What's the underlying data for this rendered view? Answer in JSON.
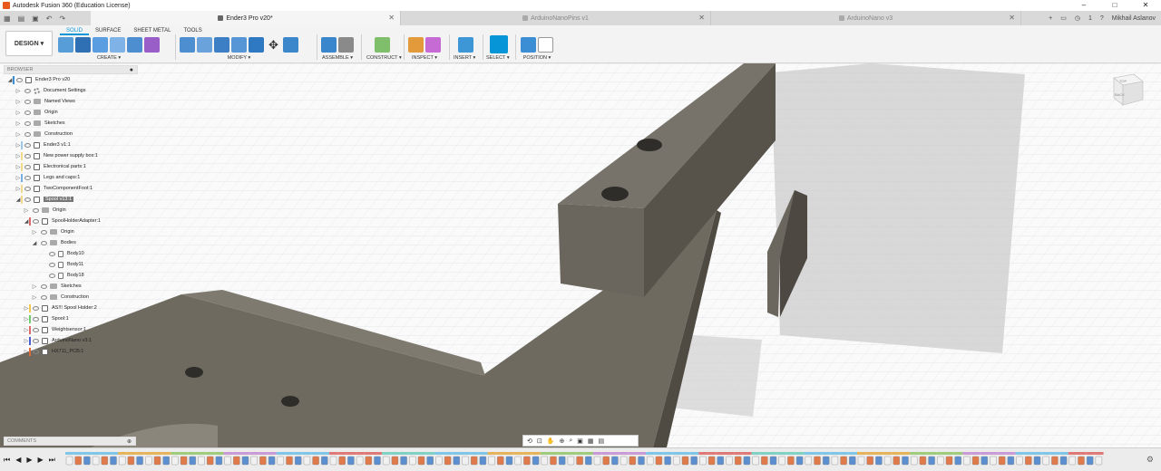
{
  "titlebar": {
    "title": "Autodesk Fusion 360 (Education License)",
    "buttons": [
      "–",
      "□",
      "✕"
    ]
  },
  "tabs": [
    {
      "label": "Ender3 Pro v20*",
      "active": true
    },
    {
      "label": "ArduinoNanoPins v1",
      "active": false
    },
    {
      "label": "ArduinoNano v3",
      "active": false
    }
  ],
  "topright": {
    "notifications": "1",
    "user": "Mikhail Aslanov"
  },
  "toolbar": {
    "design_label": "DESIGN ▾",
    "workspace_tabs": [
      "SOLID",
      "SURFACE",
      "SHEET METAL",
      "TOOLS"
    ],
    "groups": [
      {
        "label": "CREATE ▾"
      },
      {
        "label": "MODIFY ▾"
      },
      {
        "label": "ASSEMBLE ▾"
      },
      {
        "label": "CONSTRUCT ▾"
      },
      {
        "label": "INSPECT ▾"
      },
      {
        "label": "INSERT ▾"
      },
      {
        "label": "SELECT ▾"
      },
      {
        "label": "POSITION ▾"
      }
    ]
  },
  "browser": {
    "title": "BROWSER",
    "items": [
      {
        "label": "Ender3 Pro v20",
        "indent": 0,
        "icon": "doc",
        "expand": "◢",
        "bar": "#3d8fd6"
      },
      {
        "label": "Document Settings",
        "indent": 1,
        "icon": "gear",
        "expand": "▷",
        "bar": ""
      },
      {
        "label": "Named Views",
        "indent": 1,
        "icon": "folder",
        "expand": "▷",
        "bar": ""
      },
      {
        "label": "Origin",
        "indent": 1,
        "icon": "folder",
        "expand": "▷",
        "bar": ""
      },
      {
        "label": "Sketches",
        "indent": 1,
        "icon": "folder",
        "expand": "▷",
        "bar": ""
      },
      {
        "label": "Construction",
        "indent": 1,
        "icon": "folder",
        "expand": "▷",
        "bar": ""
      },
      {
        "label": "Ender3 v1:1",
        "indent": 1,
        "icon": "comp",
        "expand": "▷",
        "bar": "#9fc9ea"
      },
      {
        "label": "New power supply box:1",
        "indent": 1,
        "icon": "comp",
        "expand": "▷",
        "bar": "#f2d98b"
      },
      {
        "label": "Electronical parts:1",
        "indent": 1,
        "icon": "comp",
        "expand": "▷",
        "bar": "#f2d98b"
      },
      {
        "label": "Legs and caps:1",
        "indent": 1,
        "icon": "comp",
        "expand": "▷",
        "bar": "#7ab0e0"
      },
      {
        "label": "TwoComponentFoot:1",
        "indent": 1,
        "icon": "comp",
        "expand": "▷",
        "bar": "#f2d98b"
      },
      {
        "label": "Spool v13:1",
        "indent": 1,
        "icon": "comp",
        "expand": "◢",
        "bar": "#f2d98b",
        "highlight": true
      },
      {
        "label": "Origin",
        "indent": 2,
        "icon": "folder",
        "expand": "▷",
        "bar": ""
      },
      {
        "label": "SpoolHolderAdapter:1",
        "indent": 2,
        "icon": "comp",
        "expand": "◢",
        "bar": "#e06b6b"
      },
      {
        "label": "Origin",
        "indent": 3,
        "icon": "folder",
        "expand": "▷",
        "bar": ""
      },
      {
        "label": "Bodies",
        "indent": 3,
        "icon": "folder",
        "expand": "◢",
        "bar": ""
      },
      {
        "label": "Body10",
        "indent": 4,
        "icon": "body",
        "expand": "",
        "bar": ""
      },
      {
        "label": "Body11",
        "indent": 4,
        "icon": "body",
        "expand": "",
        "bar": ""
      },
      {
        "label": "Body18",
        "indent": 4,
        "icon": "body",
        "expand": "",
        "bar": ""
      },
      {
        "label": "Sketches",
        "indent": 3,
        "icon": "folder",
        "expand": "▷",
        "bar": ""
      },
      {
        "label": "Construction",
        "indent": 3,
        "icon": "folder",
        "expand": "▷",
        "bar": ""
      },
      {
        "label": "AS!!! Spool Holder:2",
        "indent": 2,
        "icon": "comp",
        "expand": "▷",
        "bar": "#f2c94c"
      },
      {
        "label": "Spool:1",
        "indent": 2,
        "icon": "comp",
        "expand": "▷",
        "bar": "#6ccf6c"
      },
      {
        "label": "Weightsensor:1",
        "indent": 2,
        "icon": "comp",
        "expand": "▷",
        "bar": "#e06b6b"
      },
      {
        "label": "ArduinoNano v3:1",
        "indent": 2,
        "icon": "comp",
        "expand": "▷",
        "bar": "#4a5fd0"
      },
      {
        "label": "HX711_PCB:1",
        "indent": 2,
        "icon": "comp",
        "expand": "▷",
        "bar": "#e06b3b"
      }
    ]
  },
  "viewcube": {
    "top": "TOP",
    "back": "BACK"
  },
  "comments": {
    "title": "COMMENTS"
  },
  "timeline": {
    "controls": [
      "⏮",
      "◀",
      "▶",
      "▶",
      "⏭"
    ]
  },
  "colors": {
    "accent": "#0696d7",
    "body": "#6e6a60",
    "bodyDark": "#4f4b43"
  }
}
